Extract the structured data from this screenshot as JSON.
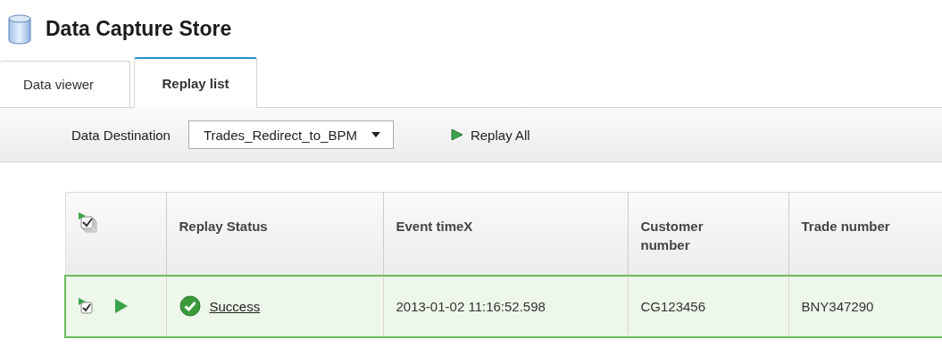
{
  "header": {
    "title": "Data Capture Store"
  },
  "tabs": [
    {
      "label": "Data viewer",
      "selected": false
    },
    {
      "label": "Replay list",
      "selected": true
    }
  ],
  "toolbar": {
    "destination_label": "Data Destination",
    "destination_value": "Trades_Redirect_to_BPM",
    "replay_all": "Replay All"
  },
  "table": {
    "columns": [
      "Replay Status",
      "Event timeX",
      "Customer number",
      "Trade number"
    ],
    "rows": [
      {
        "selected": true,
        "checked": true,
        "status": "Success",
        "kind": "success",
        "event_time": "2013-01-02 11:16:52.598",
        "customer_number": "CG123456",
        "trade_number": "BNY347290"
      }
    ]
  }
}
